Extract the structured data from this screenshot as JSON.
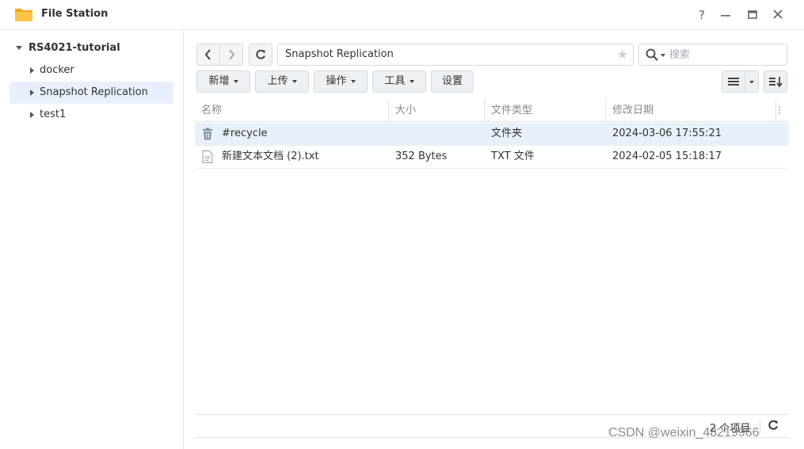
{
  "window": {
    "title": "File Station",
    "help_label": "?"
  },
  "sidebar": {
    "root_label": "RS4021-tutorial",
    "items": [
      {
        "label": "docker",
        "selected": false
      },
      {
        "label": "Snapshot Replication",
        "selected": true
      },
      {
        "label": "test1",
        "selected": false
      }
    ]
  },
  "navbar": {
    "path": "Snapshot Replication",
    "search_placeholder": "搜索"
  },
  "toolbar": {
    "new_label": "新增",
    "upload_label": "上传",
    "action_label": "操作",
    "tools_label": "工具",
    "settings_label": "设置"
  },
  "table": {
    "columns": [
      "名称",
      "大小",
      "文件类型",
      "修改日期"
    ],
    "rows": [
      {
        "name": "#recycle",
        "size": "",
        "type": "文件夹",
        "modified": "2024-03-06 17:55:21",
        "icon": "recycle-bin-icon"
      },
      {
        "name": "新建文本文档 (2).txt",
        "size": "352 Bytes",
        "type": "TXT 文件",
        "modified": "2024-02-05 15:18:17",
        "icon": "text-file-icon"
      }
    ]
  },
  "footer": {
    "count_label": "2 个项目"
  },
  "watermark": "CSDN @weixin_48219966",
  "colors": {
    "accent_selected": "#e8f1fb",
    "folder_yellow": "#f6b93b",
    "button_bg": "#eef1f4"
  }
}
